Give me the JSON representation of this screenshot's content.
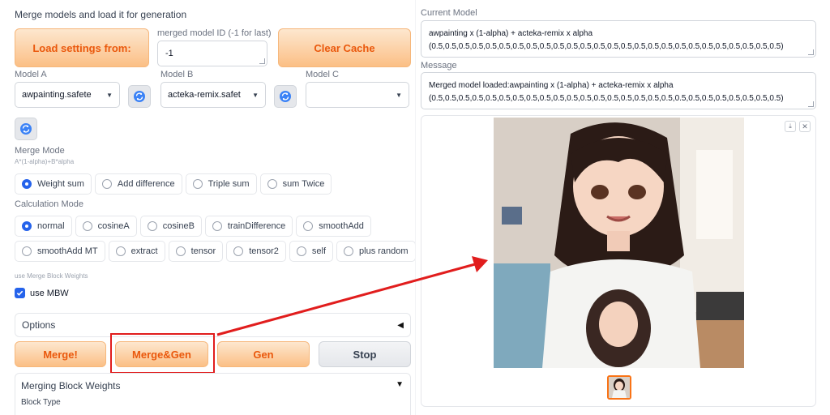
{
  "left": {
    "section_title": "Merge models and load it for generation",
    "load_settings_label": "Load settings from:",
    "model_id_label": "merged model ID (-1 for last)",
    "model_id_value": "-1",
    "clear_cache_label": "Clear Cache",
    "model_a_label": "Model A",
    "model_a_value": "awpainting.safete",
    "model_b_label": "Model B",
    "model_b_value": "acteka-remix.safet",
    "model_c_label": "Model C",
    "model_c_value": "",
    "merge_mode_label": "Merge Mode",
    "merge_mode_formula": "A*(1-alpha)+B*alpha",
    "merge_modes": [
      "Weight sum",
      "Add difference",
      "Triple sum",
      "sum Twice"
    ],
    "merge_mode_selected": "Weight sum",
    "calc_mode_label": "Calculation Mode",
    "calc_modes_row1": [
      "normal",
      "cosineA",
      "cosineB",
      "trainDifference",
      "smoothAdd"
    ],
    "calc_modes_row2": [
      "smoothAdd MT",
      "extract",
      "tensor",
      "tensor2",
      "self",
      "plus random"
    ],
    "calc_mode_selected": "normal",
    "mbw_section_label": "use Merge Block Weights",
    "use_mbw_label": "use MBW",
    "use_mbw_checked": true,
    "options_label": "Options",
    "merge_button": "Merge!",
    "merge_gen_button": "Merge&Gen",
    "gen_button": "Gen",
    "stop_button": "Stop",
    "block_weights_label": "Merging Block Weights",
    "block_type_label": "Block Type"
  },
  "right": {
    "current_model_label": "Current Model",
    "current_model_line1": "awpainting x (1-alpha) + acteka-remix x alpha",
    "current_model_line2": "(0.5,0.5,0.5,0.5,0.5,0.5,0.5,0.5,0.5,0.5,0.5,0.5,0.5,0.5,0.5,0.5,0.5,0.5,0.5,0.5,0.5,0.5,0.5,0.5,0.5,0.5)",
    "message_label": "Message",
    "message_line1": "Merged model loaded:awpainting x (1-alpha) + acteka-remix x alpha",
    "message_line2": "(0.5,0.5,0.5,0.5,0.5,0.5,0.5,0.5,0.5,0.5,0.5,0.5,0.5,0.5,0.5,0.5,0.5,0.5,0.5,0.5,0.5,0.5,0.5,0.5,0.5,0.5)"
  },
  "colors": {
    "accent_orange": "#f97316",
    "highlight_red": "#e11d1d",
    "radio_blue": "#2563eb"
  }
}
